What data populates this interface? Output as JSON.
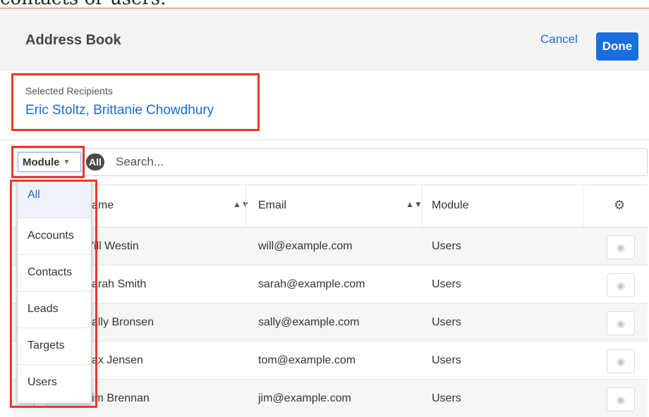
{
  "doc_text": "contacts or users.",
  "header": {
    "title": "Address Book",
    "cancel_label": "Cancel",
    "done_label": "Done"
  },
  "recipients": {
    "label": "Selected Recipients",
    "value": "Eric Stoltz, Brittanie Chowdhury"
  },
  "filter": {
    "module_label": "Module",
    "all_pill": "All",
    "search_placeholder": "Search..."
  },
  "table": {
    "columns": [
      "ame",
      "Email",
      "Module"
    ],
    "rows": [
      {
        "name": "'ill Westin",
        "email": "will@example.com",
        "module": "Users"
      },
      {
        "name": "arah Smith",
        "email": "sarah@example.com",
        "module": "Users"
      },
      {
        "name": "ally Bronsen",
        "email": "sally@example.com",
        "module": "Users"
      },
      {
        "name": "ax Jensen",
        "email": "tom@example.com",
        "module": "Users"
      },
      {
        "name": "im Brennan",
        "email": "jim@example.com",
        "module": "Users"
      }
    ]
  },
  "dropdown": {
    "items": [
      "All",
      "Accounts",
      "Contacts",
      "Leads",
      "Targets",
      "Users"
    ],
    "selected": "All"
  },
  "colors": {
    "accent": "#1a6fe0",
    "highlight": "#e8392a"
  }
}
